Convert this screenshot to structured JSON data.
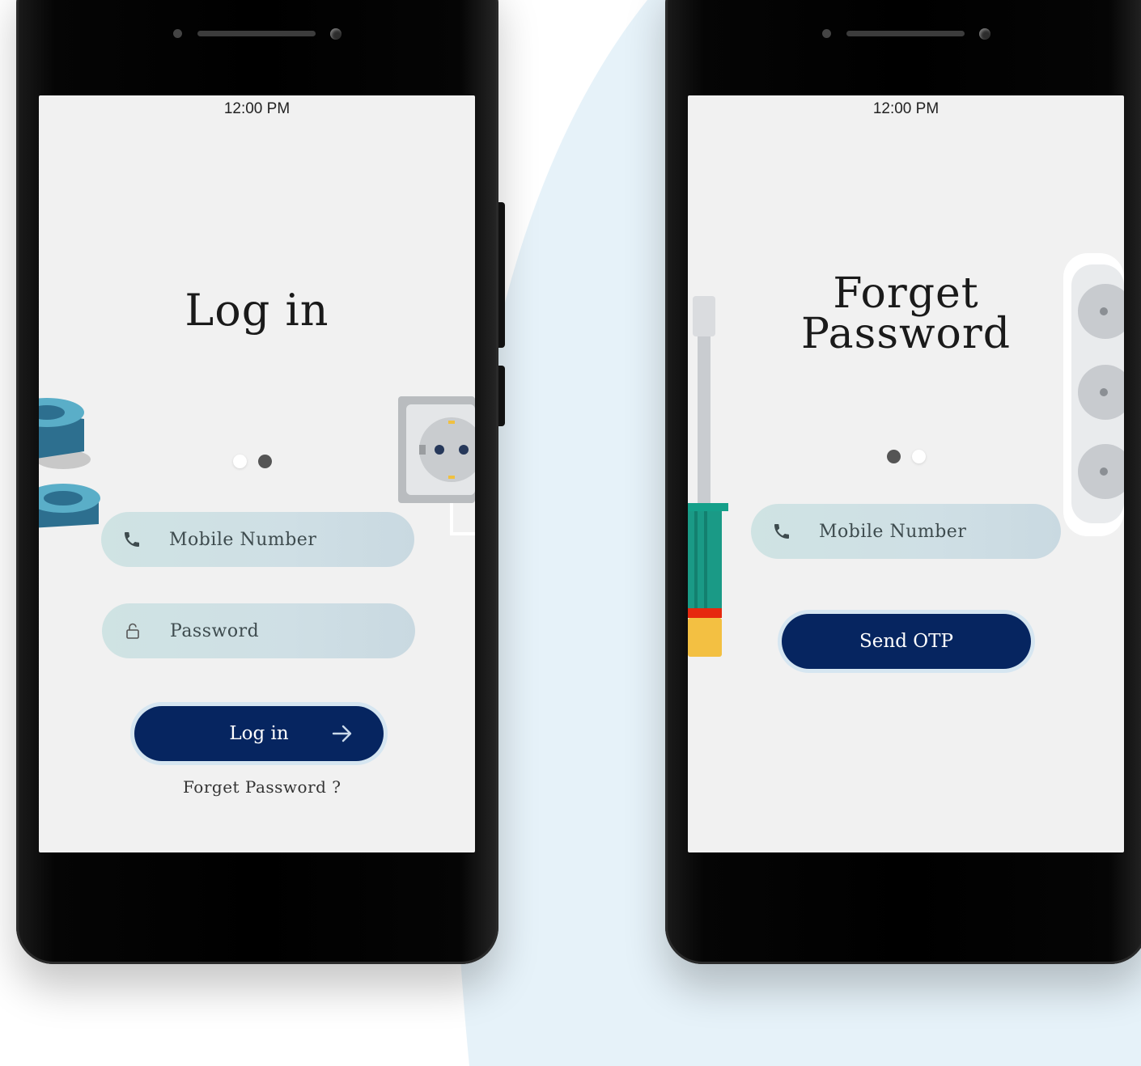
{
  "login_screen": {
    "status_time": "12:00 PM",
    "title": "Log in",
    "pager": {
      "total": 2,
      "active_index": 2
    },
    "mobile_placeholder": "Mobile Number",
    "password_placeholder": "Password",
    "login_button": "Log in",
    "forgot_link": "Forget Password ?",
    "icons": [
      "phone-icon",
      "lock-icon",
      "arrow-right-icon"
    ]
  },
  "forgot_screen": {
    "status_time": "12:00 PM",
    "title_line1": "Forget",
    "title_line2": "Password",
    "pager": {
      "total": 2,
      "active_index": 1
    },
    "mobile_placeholder": "Mobile Number",
    "send_button": "Send OTP",
    "icons": [
      "phone-icon"
    ]
  },
  "colors": {
    "button": "#062560",
    "field": "#cfe3e3",
    "screen_bg": "#f1f1f1",
    "background_swoosh": "#e6f2f9"
  }
}
